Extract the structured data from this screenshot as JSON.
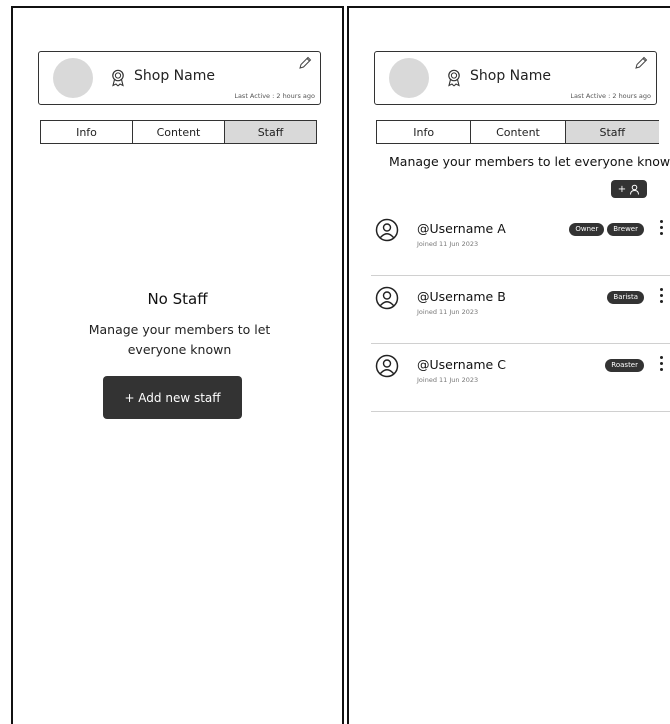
{
  "shop": {
    "name": "Shop Name",
    "last_active": "Last Active : 2 hours ago"
  },
  "tabs": [
    {
      "label": "Info",
      "active": false
    },
    {
      "label": "Content",
      "active": false
    },
    {
      "label": "Staff",
      "active": true
    }
  ],
  "empty_state": {
    "title": "No Staff",
    "description": "Manage your members to let everyone known",
    "button_label": "+ Add new staff"
  },
  "staff_list": {
    "heading": "Manage your members to let everyone known",
    "add_button_label": "+",
    "members": [
      {
        "handle": "@Username A",
        "joined": "Joined 11 Jun 2023",
        "roles": [
          "Owner",
          "Brewer"
        ]
      },
      {
        "handle": "@Username B",
        "joined": "Joined 11 Jun 2023",
        "roles": [
          "Barista"
        ]
      },
      {
        "handle": "@Username C",
        "joined": "Joined 11 Jun 2023",
        "roles": [
          "Roaster"
        ]
      }
    ]
  },
  "icons": {
    "shop_badge": "award-badge-icon",
    "edit": "pencil-icon",
    "member_avatar": "user-circle-icon",
    "more": "kebab-menu-icon",
    "add_member": "user-plus-icon"
  },
  "colors": {
    "dark_button": "#333333",
    "active_tab": "#d9d9d9",
    "avatar_placeholder": "#d9d9d9"
  }
}
